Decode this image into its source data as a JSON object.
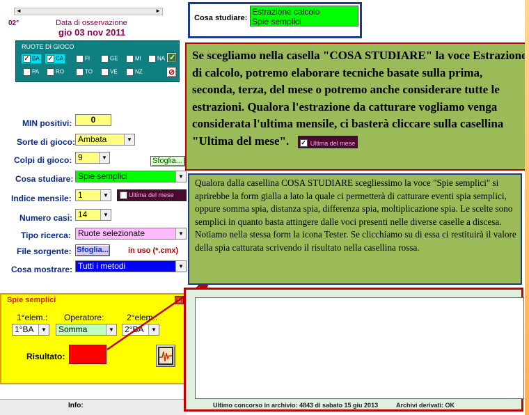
{
  "form": {
    "temperature": "02°",
    "date_caption": "Data di osservazione",
    "date_value": "gio 03 nov 2011",
    "ruote_title": "RUOTE DI GIOCO",
    "ruote": [
      {
        "label": "BA",
        "checked": true
      },
      {
        "label": "CA",
        "checked": true
      },
      {
        "label": "FI",
        "checked": false
      },
      {
        "label": "GE",
        "checked": false
      },
      {
        "label": "MI",
        "checked": false
      },
      {
        "label": "NA",
        "checked": false
      },
      {
        "label": "PA",
        "checked": false
      },
      {
        "label": "RO",
        "checked": false
      },
      {
        "label": "TO",
        "checked": false
      },
      {
        "label": "VE",
        "checked": false
      },
      {
        "label": "NZ",
        "checked": false
      }
    ],
    "ruote_check_btn": "✓",
    "ruote_clear_btn": "⊘",
    "min_positivi_label": "MIN positivi:",
    "min_positivi_value": "0",
    "sorte_label": "Sorte di gioco:",
    "sorte_value": "Ambata",
    "colpi_label": "Colpi di gioco:",
    "colpi_value": "9",
    "sfoglia_small": "Sfoglia...",
    "cosa_studiare_label": "Cosa studiare:",
    "cosa_studiare_value": "Spie semplici",
    "indice_label": "Indice mensile:",
    "indice_value": "1",
    "ultima_mese_label": "Ultima del mese",
    "numero_casi_label": "Numero casi:",
    "numero_casi_value": "14",
    "tipo_ricerca_label": "Tipo ricerca:",
    "tipo_ricerca_value": "Ruote selezionate",
    "file_sorgente_label": "File sorgente:",
    "file_sorgente_btn": "Sfoglia...",
    "in_uso_text": "in uso (*.cmx)",
    "cosa_mostrare_label": "Cosa mostrare:",
    "cosa_mostrare_value": "Tutti i metodi",
    "info_label": "Info:"
  },
  "spie": {
    "title": "Spie semplici",
    "close": "x",
    "elem1_label": "1°elem.:",
    "elem1_value": "1°BA",
    "operatore_label": "Operatore:",
    "operatore_value": "Somma",
    "elem2_label": "2°elem.:",
    "elem2_value": "2°BA",
    "risultato_label": "Risultato:",
    "result_color": "#ff0000"
  },
  "top_panel": {
    "label": "Cosa studiare:",
    "options": [
      "Estrazione calcolo",
      "Spie semplici"
    ]
  },
  "notes": {
    "note1": "Se scegliamo nella casella \"COSA STUDIARE\" la voce Estrazione di calcolo, potremo elaborare tecniche basate sulla prima, seconda, terza, del mese o potremo anche considerare tutte le estrazioni. Qualora l'estrazione da catturare vogliamo venga considerata l'ultima mensile, ci basterà cliccare sulla casellina \"Ultima del mese\".",
    "note1_badge": "Ultima del mese",
    "note2": "Qualora dalla casellina COSA STUDIARE scegliessimo la voce \"Spie semplici\" si aprirebbe la form gialla a lato la quale ci permetterà di catturare eventi spia semplici, oppure somma spia, distanza spia, differenza spia, moltiplicazione spia. Le scelte sono semplici in quanto basta attingere dalle voci presenti nelle diverse caselle a discesa. Notiamo nella stessa form la icona Tester. Se clicchiamo su di essa ci restituirà il valore della spia catturata scrivendo il risultato nella casellina rossa."
  },
  "status": {
    "archive_text": "Ultimo concorso in archivio: 4843 di sabato 15 giu 2013",
    "derived_text": "Archivi derivati: OK"
  },
  "colors": {
    "note_bg": "#9bbb59",
    "yellow_panel": "#ffff00",
    "green_select": "#00ff00",
    "pink_select": "#ffbbff",
    "blue_select": "#0000ff",
    "red_border": "#c00000",
    "blue_border": "#1f3a8a"
  }
}
